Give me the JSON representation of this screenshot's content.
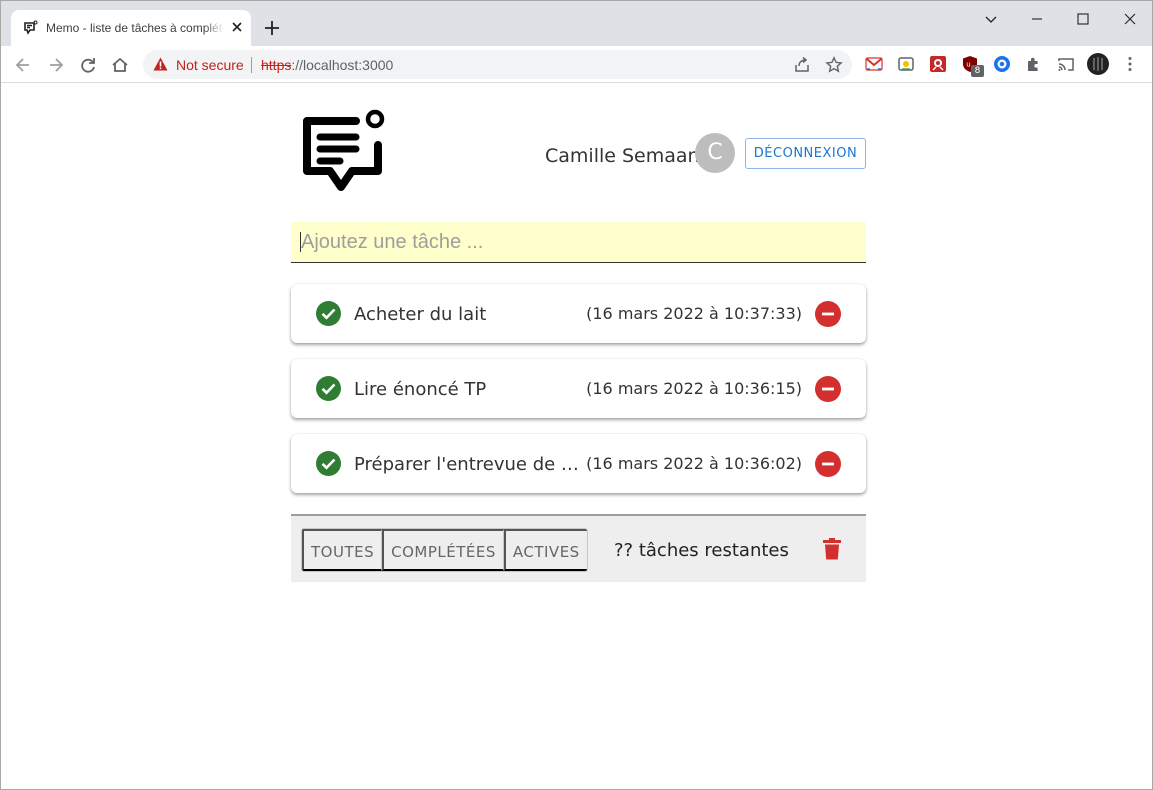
{
  "browser": {
    "tab_title": "Memo - liste de tâches à compléter",
    "security_label": "Not secure",
    "url_scheme": "https",
    "url_rest": "://localhost:3000",
    "extension_badge": "8"
  },
  "header": {
    "user_name": "Camille Semaan",
    "avatar_letter": "C",
    "logout_label": "DÉCONNEXION"
  },
  "new_task": {
    "placeholder": "Ajoutez une tâche ..."
  },
  "tasks": [
    {
      "text": "Acheter du lait",
      "date": "(16 mars 2022 à 10:37:33)",
      "completed": true
    },
    {
      "text": "Lire énoncé TP",
      "date": "(16 mars 2022 à 10:36:15)",
      "completed": true
    },
    {
      "text": "Préparer l'entrevue de s...",
      "date": "(16 mars 2022 à 10:36:02)",
      "completed": true
    }
  ],
  "footer": {
    "filters": [
      "TOUTES",
      "COMPLÉTÉES",
      "ACTIVES"
    ],
    "remaining": "?? tâches restantes"
  },
  "colors": {
    "accent": "#1976d2",
    "check": "#2e7d32",
    "delete": "#d32f2f",
    "input_bg": "#ffffcc"
  }
}
